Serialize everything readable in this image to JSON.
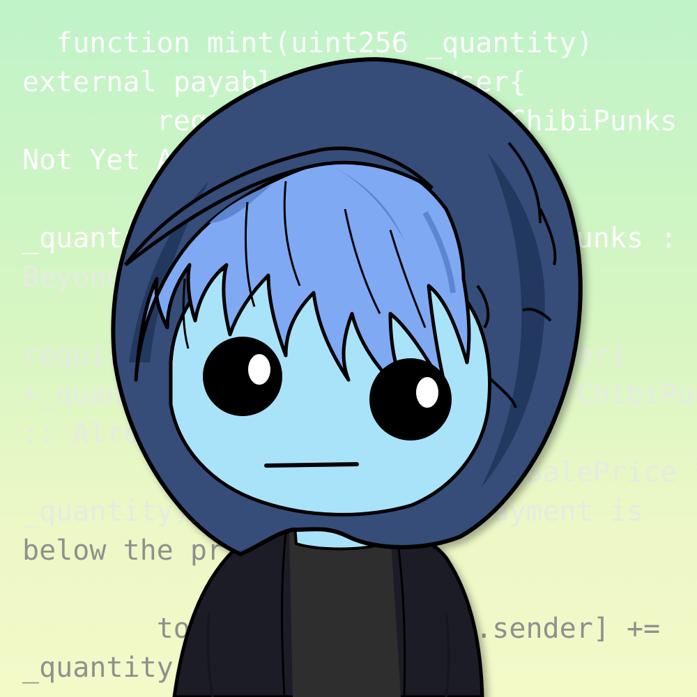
{
  "code_lines": [
    "  function mint(uint256 _quantity)",
    "external payable callerIsUser{",
    "        require(publicSale, \"ChibiPunks",
    "Not Yet Active.\");",
    "        require((totalSupply() +",
    "_quantity) <= MAX_SUPPLY, \"ChibiPunks :",
    "Beyond Max Supply\");",
    "",
    "require((totalPublicMint[msg.sender]",
    "+_quantity) <= MAX_PUBLIC_MINT, \"ChibiPunks",
    ":: Already minted 3 times!\");",
    "        require(msg.value >= (SalePrice *",
    "_quantity), \"ChibiPunks :: Payment is",
    "below the price\");",
    "",
    "        totalPublicMint[msg.sender] +=",
    "_quantity;"
  ],
  "colors": {
    "hood": "#344d78",
    "hood_shadow": "#22385f",
    "hair": "#7fa9f3",
    "hair_shadow": "#5c86cf",
    "skin": "#a9e3f9",
    "jacket": "#1f1f27",
    "shirt": "#2e2e2e",
    "outline": "#000000"
  }
}
